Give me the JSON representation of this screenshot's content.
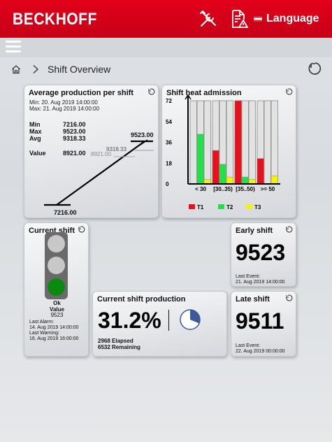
{
  "header": {
    "logo": "BECKHOFF",
    "language_label": "Language",
    "tools_icon": "tools-icon",
    "document_warning_icon": "document-warning-icon",
    "flag_icon": "flag-icon"
  },
  "breadcrumb": {
    "title": "Shift Overview"
  },
  "avg_production": {
    "title": "Average production per shift",
    "min_date": "Min:  20. Aug 2019 14:00:00",
    "max_date": "Max: 21. Aug 2019 14:00:00",
    "stats": [
      {
        "label": "Min",
        "value": "7216.00"
      },
      {
        "label": "Max",
        "value": "9523.00"
      },
      {
        "label": "Avg",
        "value": "9318.33"
      },
      {
        "label": "Value",
        "value": "8921.00"
      }
    ],
    "chart_labels": {
      "max": "9523.00",
      "avg": "9318.33",
      "value": "8921.00",
      "min": "7216.00"
    }
  },
  "chart_data": {
    "type": "bar",
    "title": "Shift heat admission",
    "categories": [
      "< 30",
      "[30..35)",
      "[35..50)",
      ">= 50"
    ],
    "ylim": [
      0,
      72
    ],
    "yticks": [
      "72",
      "54",
      "36",
      "18",
      "0"
    ],
    "series": [
      {
        "name": "T1",
        "color": "#e8101a",
        "values": [
          0,
          29,
          72,
          22
        ]
      },
      {
        "name": "T2",
        "color": "#22e04a",
        "values": [
          43,
          17,
          6,
          0
        ]
      },
      {
        "name": "T3",
        "color": "#f2f20a",
        "values": [
          4,
          6,
          4,
          7
        ]
      }
    ]
  },
  "current_shift": {
    "title": "Current shift",
    "status": "Ok",
    "value_label": "Value",
    "value": "9523",
    "last_alarm_label": "Last Alarm:",
    "last_alarm": "14. Aug 2019 14:00:00",
    "last_warning_label": "Last Warning:",
    "last_warning": "16. Aug 2019 16:00:00",
    "active_light": "green"
  },
  "early_shift": {
    "title": "Early shift",
    "value": "9523",
    "last_event_label": "Last Event:",
    "last_event": "21. Aug 2019 14:00:00"
  },
  "late_shift": {
    "title": "Late shift",
    "value": "9511",
    "last_event_label": "Last Event:",
    "last_event": "22. Aug 2019 00:00:00"
  },
  "production": {
    "title": "Current shift production",
    "percent": "31.2%",
    "percent_fraction": 0.312,
    "elapsed": "2968 Elapsed",
    "remaining": "6532 Remaining"
  }
}
